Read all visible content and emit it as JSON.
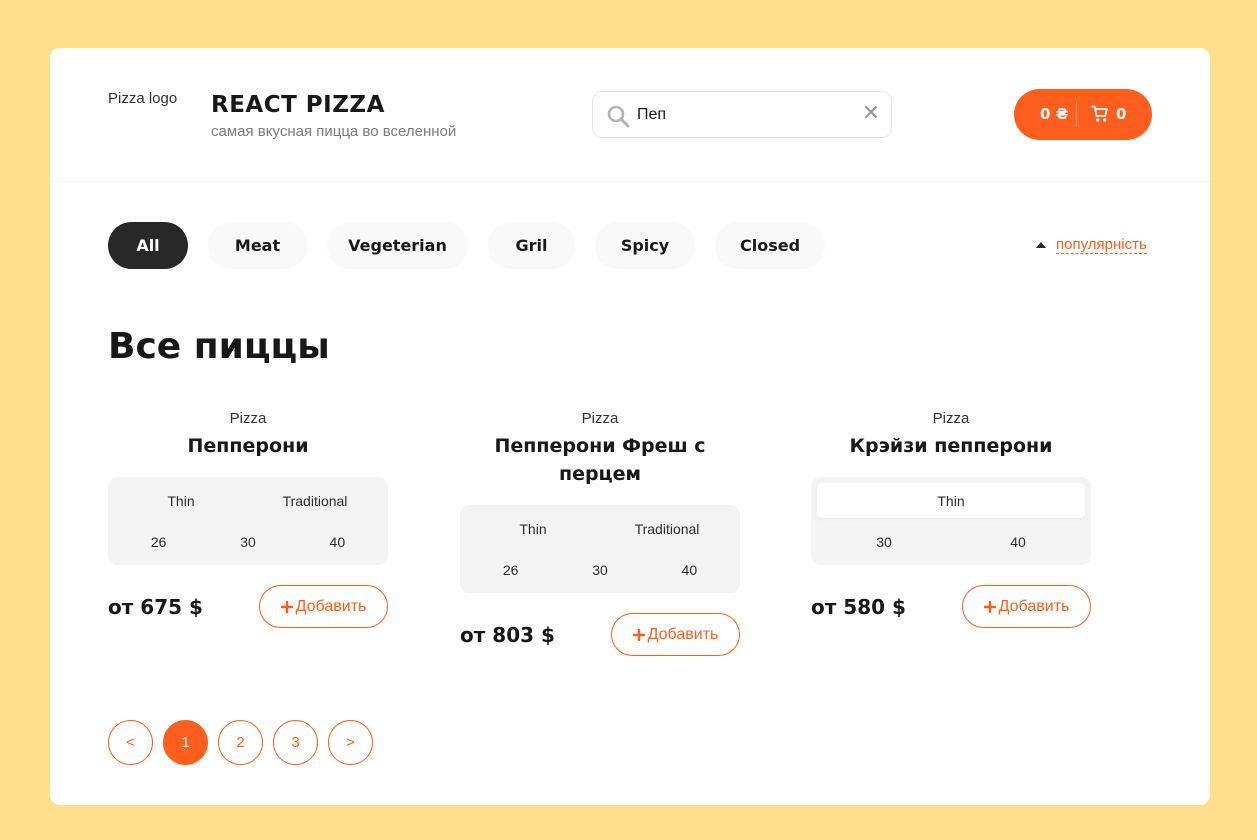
{
  "header": {
    "logo_alt": "Pizza logo",
    "title": "REACT PIZZA",
    "subtitle": "самая вкусная пицца во вселенной",
    "search": {
      "value": "Пеп"
    },
    "cart": {
      "price": "0 ₴",
      "count": "0"
    }
  },
  "categories": [
    "All",
    "Meat",
    "Vegeterian",
    "Gril",
    "Spicy",
    "Closed"
  ],
  "active_category": "All",
  "sort": {
    "value": "популярність"
  },
  "content_title": "Все пиццы",
  "pizzas": [
    {
      "img_alt": "Pizza",
      "title": "Пепперони",
      "types": [
        "Thin",
        "Traditional"
      ],
      "sizes": [
        "26",
        "30",
        "40"
      ],
      "price": "от 675 $",
      "add_label": "Добавить"
    },
    {
      "img_alt": "Pizza",
      "title": "Пепперони Фреш с перцем",
      "types": [
        "Thin",
        "Traditional"
      ],
      "sizes": [
        "26",
        "30",
        "40"
      ],
      "price": "от 803 $",
      "add_label": "Добавить"
    },
    {
      "img_alt": "Pizza",
      "title": "Крэйзи пепперони",
      "types": [
        "Thin"
      ],
      "active_type": "Thin",
      "sizes": [
        "30",
        "40"
      ],
      "price": "от 580 $",
      "add_label": "Добавить"
    }
  ],
  "pagination": {
    "prev": "<",
    "pages": [
      "1",
      "2",
      "3"
    ],
    "active_page": "1",
    "next": ">"
  },
  "colors": {
    "accent": "#fe5f1e",
    "background": "#ffdf8c",
    "dark": "#282828"
  }
}
